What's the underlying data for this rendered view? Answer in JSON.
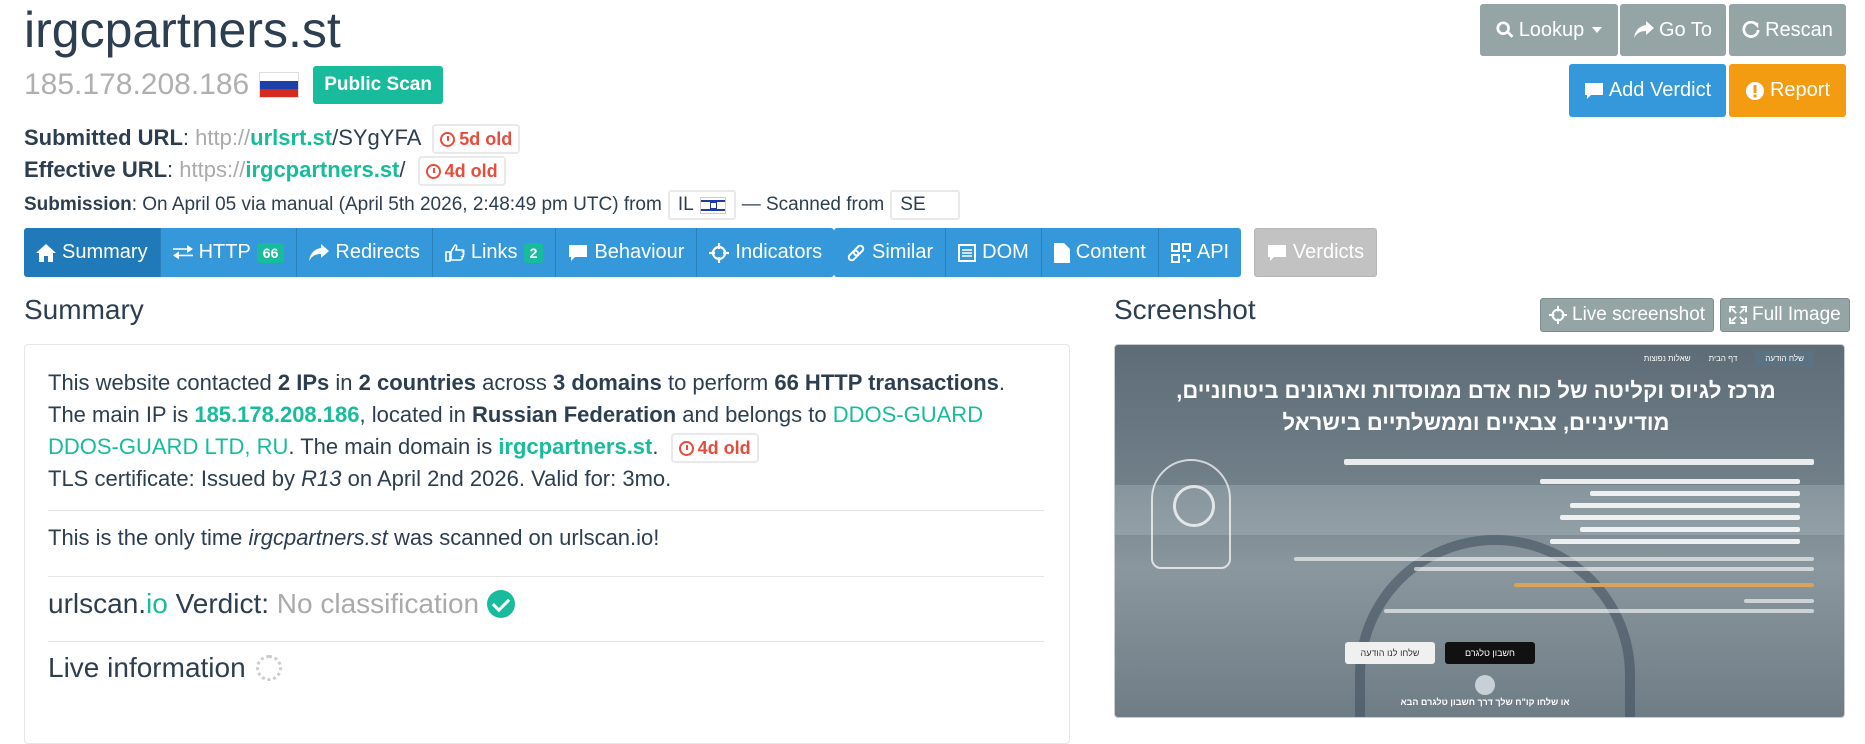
{
  "header": {
    "domain": "irgcpartners.st",
    "ip": "185.178.208.186",
    "public_scan_label": "Public Scan"
  },
  "info": {
    "submitted_label": "Submitted URL",
    "submitted_scheme": "http://",
    "submitted_host": "urlsrt.st",
    "submitted_path": "/SYgYFA",
    "submitted_age": "5d old",
    "effective_label": "Effective URL",
    "effective_scheme": "https://",
    "effective_host": "irgcpartners.st",
    "effective_path": "/",
    "effective_age": "4d old",
    "submission_label": "Submission",
    "submission_text": ": On April 05 via manual (April 5th 2026, 2:48:49 pm UTC) from",
    "from_country": "IL",
    "scanned_from_label": "— Scanned from",
    "scanned_country": "SE"
  },
  "actions": {
    "lookup": "Lookup",
    "goto": "Go To",
    "rescan": "Rescan",
    "add_verdict": "Add Verdict",
    "report": "Report"
  },
  "tabs": {
    "summary": "Summary",
    "http": "HTTP",
    "http_count": "66",
    "redirects": "Redirects",
    "links": "Links",
    "links_count": "2",
    "behaviour": "Behaviour",
    "indicators": "Indicators",
    "similar": "Similar",
    "dom": "DOM",
    "content": "Content",
    "api": "API",
    "verdicts": "Verdicts"
  },
  "summary": {
    "title": "Summary",
    "p1_a": "This website contacted ",
    "ips": "2 IPs",
    "p1_b": " in ",
    "countries": "2 countries",
    "p1_c": " across ",
    "domains": "3 domains",
    "p1_d": " to perform ",
    "transactions": "66 HTTP transactions",
    "p1_e": ". The main IP is ",
    "main_ip": "185.178.208.186",
    "p1_f": ", located in ",
    "country": "Russian Federation",
    "p1_g": " and belongs to ",
    "asn": "DDOS-GUARD DDOS-GUARD LTD, RU",
    "p1_h": ". The main domain is ",
    "main_domain": "irgcpartners.st",
    "p1_i": ".",
    "main_domain_age": "4d old",
    "tls_a": "TLS certificate: Issued by ",
    "tls_issuer": "R13",
    "tls_b": " on April 2nd 2026. Valid for: 3mo.",
    "only_a": "This is the only time ",
    "only_domain": "irgcpartners.st",
    "only_b": " was scanned on urlscan.io!",
    "verdict_brand_a": "urlscan.",
    "verdict_brand_b": "io",
    "verdict_label": " Verdict: ",
    "verdict_value": "No classification",
    "live_info": "Live information"
  },
  "screenshot": {
    "title": "Screenshot",
    "live_btn": "Live screenshot",
    "full_btn": "Full Image",
    "headline": "מרכז לגיוס וקליטה של כוח אדם ממוסדות וארגונים ביטחוניים, מודיעיניים, צבאיים וממשלתיים בישראל",
    "nav_send": "שלח הודעה",
    "nav_faq": "שאלות נפוצות",
    "nav_home": "דף הבית",
    "btn_telegram": "חשבון טלגרם",
    "btn_message": "שלחו לנו הודעה",
    "footer": "או שלחו קו\"ח שלך דרך חשבון טלגרם הבא"
  }
}
